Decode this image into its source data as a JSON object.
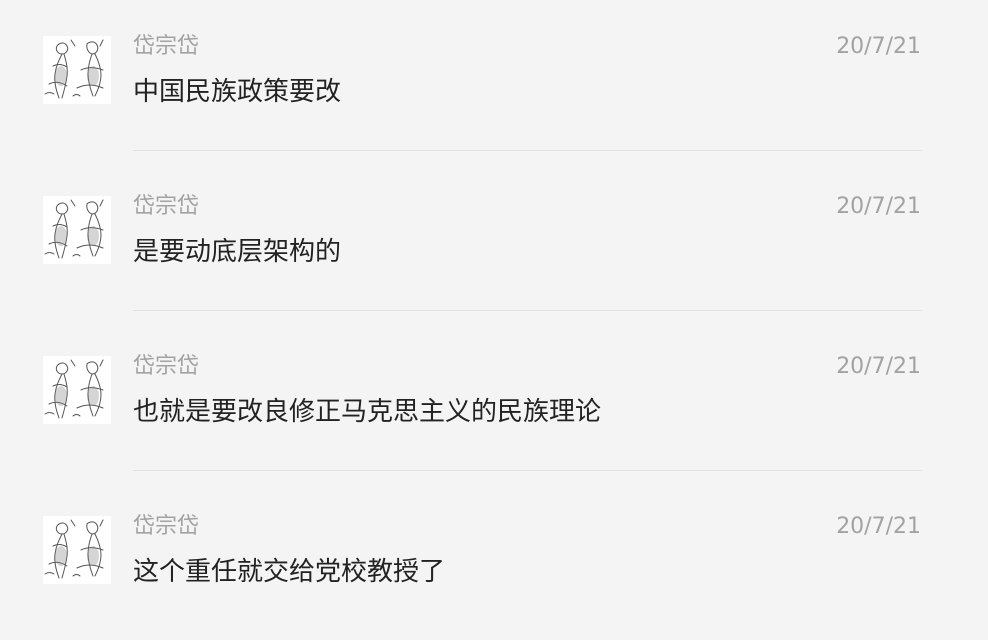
{
  "messages": [
    {
      "sender": "岱宗岱",
      "time": "20/7/21",
      "text": "中国民族政策要改"
    },
    {
      "sender": "岱宗岱",
      "time": "20/7/21",
      "text": "是要动底层架构的"
    },
    {
      "sender": "岱宗岱",
      "time": "20/7/21",
      "text": "也就是要改良修正马克思主义的民族理论"
    },
    {
      "sender": "岱宗岱",
      "time": "20/7/21",
      "text": "这个重任就交给党校教授了"
    }
  ]
}
